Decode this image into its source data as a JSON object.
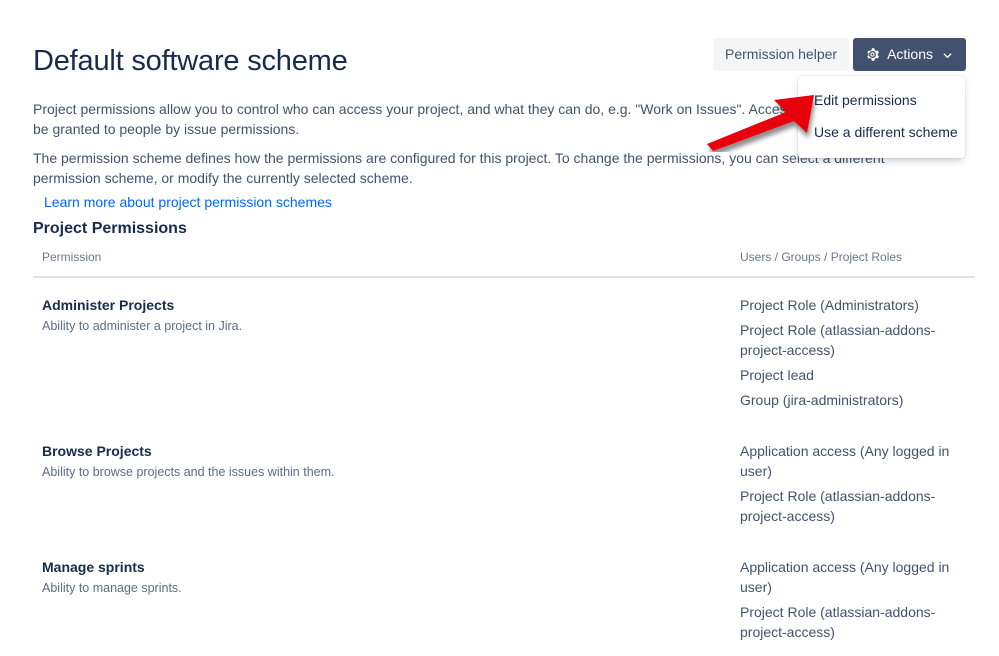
{
  "header": {
    "title": "Default software scheme",
    "permission_helper_label": "Permission helper",
    "actions_label": "Actions",
    "gear_icon": "gear-icon",
    "chevron_icon": "chevron-down-icon",
    "actions_bg_color": "#42526E",
    "subtle_bg_color": "#F4F5F7"
  },
  "dropdown": {
    "items": [
      {
        "label": "Edit permissions"
      },
      {
        "label": "Use a different scheme"
      }
    ]
  },
  "intro": {
    "paragraph1": "Project permissions allow you to control who can access your project, and what they can do, e.g. \"Work on Issues\". Access to your project can also be granted to people by issue permissions.",
    "paragraph2": "The permission scheme defines how the permissions are configured for this project. To change the permissions, you can select a different permission scheme, or modify the currently selected scheme.",
    "learn_more_link": "Learn more about project permission schemes",
    "link_color": "#0065FF"
  },
  "section": {
    "title": "Project Permissions"
  },
  "table": {
    "columns": {
      "permission": "Permission",
      "users": "Users / Groups / Project Roles"
    },
    "rows": [
      {
        "name": "Administer Projects",
        "description": "Ability to administer a project in Jira.",
        "grantees": [
          "Project Role (Administrators)",
          "Project Role (atlassian-addons-project-access)",
          "Project lead",
          "Group (jira-administrators)"
        ]
      },
      {
        "name": "Browse Projects",
        "description": "Ability to browse projects and the issues within them.",
        "grantees": [
          "Application access (Any logged in user)",
          "Project Role (atlassian-addons-project-access)"
        ]
      },
      {
        "name": "Manage sprints",
        "description": "Ability to manage sprints.",
        "grantees": [
          "Application access (Any logged in user)",
          "Project Role (atlassian-addons-project-access)"
        ]
      }
    ]
  },
  "annotation": {
    "arrow_color": "#E8000D",
    "arrow_name": "red-pointer-arrow"
  }
}
